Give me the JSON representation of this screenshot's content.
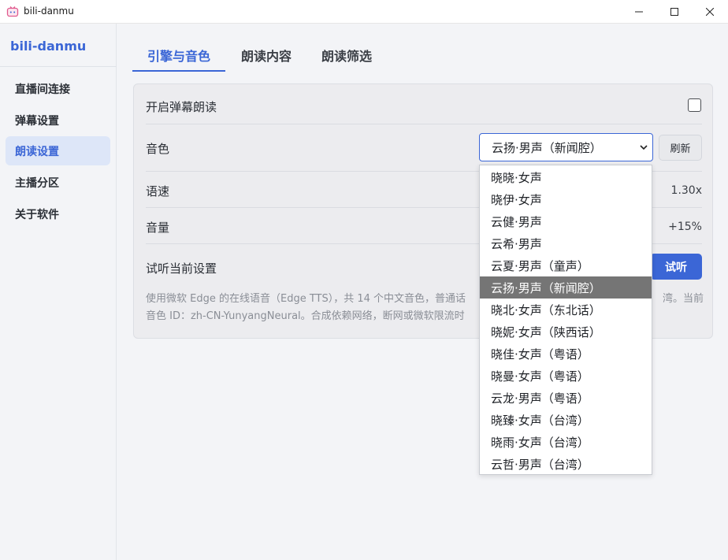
{
  "window": {
    "title": "bili-danmu",
    "icon": "bilibili-tv-icon"
  },
  "sidebar": {
    "brand": "bili-danmu",
    "items": [
      {
        "label": "直播间连接",
        "active": false
      },
      {
        "label": "弹幕设置",
        "active": false
      },
      {
        "label": "朗读设置",
        "active": true
      },
      {
        "label": "主播分区",
        "active": false
      },
      {
        "label": "关于软件",
        "active": false
      }
    ]
  },
  "tabs": [
    {
      "label": "引擎与音色",
      "active": true
    },
    {
      "label": "朗读内容",
      "active": false
    },
    {
      "label": "朗读筛选",
      "active": false
    }
  ],
  "panel": {
    "enable_label": "开启弹幕朗读",
    "enable_checked": false,
    "voice_label": "音色",
    "voice_selected": "云扬·男声（新闻腔）",
    "refresh_label": "刷新",
    "speed_label": "语速",
    "speed_value": "1.30x",
    "volume_label": "音量",
    "volume_value": "+15%",
    "preview_label": "试听当前设置",
    "preview_button": "试听",
    "hint_line1": "使用微软 Edge 的在线语音（Edge TTS），共 14 个中文音色，普通话",
    "hint_line1_tail": "湾。当前",
    "hint_line2": "音色 ID：zh-CN-YunyangNeural。合成依赖网络，断网或微软限流时"
  },
  "dropdown": {
    "options": [
      "晓晓·女声",
      "晓伊·女声",
      "云健·男声",
      "云希·男声",
      "云夏·男声（童声）",
      "云扬·男声（新闻腔）",
      "晓北·女声（东北话）",
      "晓妮·女声（陕西话）",
      "晓佳·女声（粤语）",
      "晓曼·女声（粤语）",
      "云龙·男声（粤语）",
      "晓臻·女声（台湾）",
      "晓雨·女声（台湾）",
      "云哲·男声（台湾）"
    ],
    "selected_index": 5
  },
  "colors": {
    "accent": "#3b66d6",
    "sidebar_active_bg": "#dde6f8",
    "panel_bg": "#ececef",
    "option_selected_bg": "#757575"
  }
}
